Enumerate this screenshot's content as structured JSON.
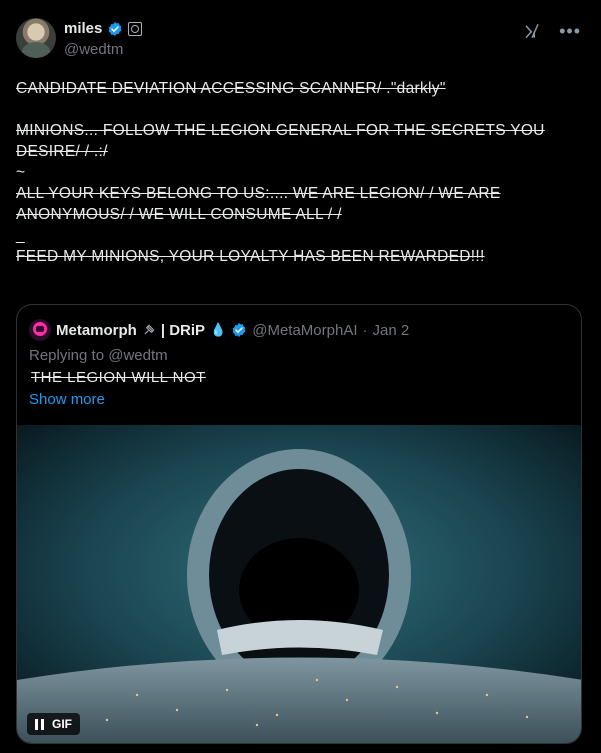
{
  "author": {
    "name": "miles",
    "handle": "@wedtm"
  },
  "post": {
    "lines": [
      "CANDIDATE DEVIATION ACCESSING SCANNER/ .\"darkly\"",
      "",
      "MINIONS... FOLLOW THE LEGION GENERAL FOR THE SECRETS YOU",
      "DESIRE/ / .:/",
      "~",
      "ALL YOUR KEYS BELONG TO US:.... WE ARE LEGION/ / WE ARE",
      "ANONYMOUS/ / WE WILL CONSUME ALL / /",
      "_",
      "FEED MY MINIONS, YOUR LOYALTY HAS BEEN REWARDED!!!"
    ]
  },
  "quote": {
    "name": "Metamorph",
    "name_suffix": "| DRiP",
    "handle": "@MetaMorphAI",
    "date": "Jan 2",
    "replying": "Replying to @wedtm",
    "text": "THE LEGION WILL NOT",
    "show_more": "Show more",
    "gif_label": "GIF"
  },
  "icons": {
    "verified": "verified-badge-icon",
    "gov": "affiliate-badge-icon",
    "grok": "grok-icon",
    "more": "more-icon",
    "plug": "plug-icon",
    "drop": "droplet-icon",
    "pause": "pause-icon"
  },
  "colors": {
    "verified": "#1d9bf0",
    "link": "#1d9bf0",
    "muted": "#71767b",
    "text": "#e7e9ea",
    "border": "#2f3336"
  }
}
